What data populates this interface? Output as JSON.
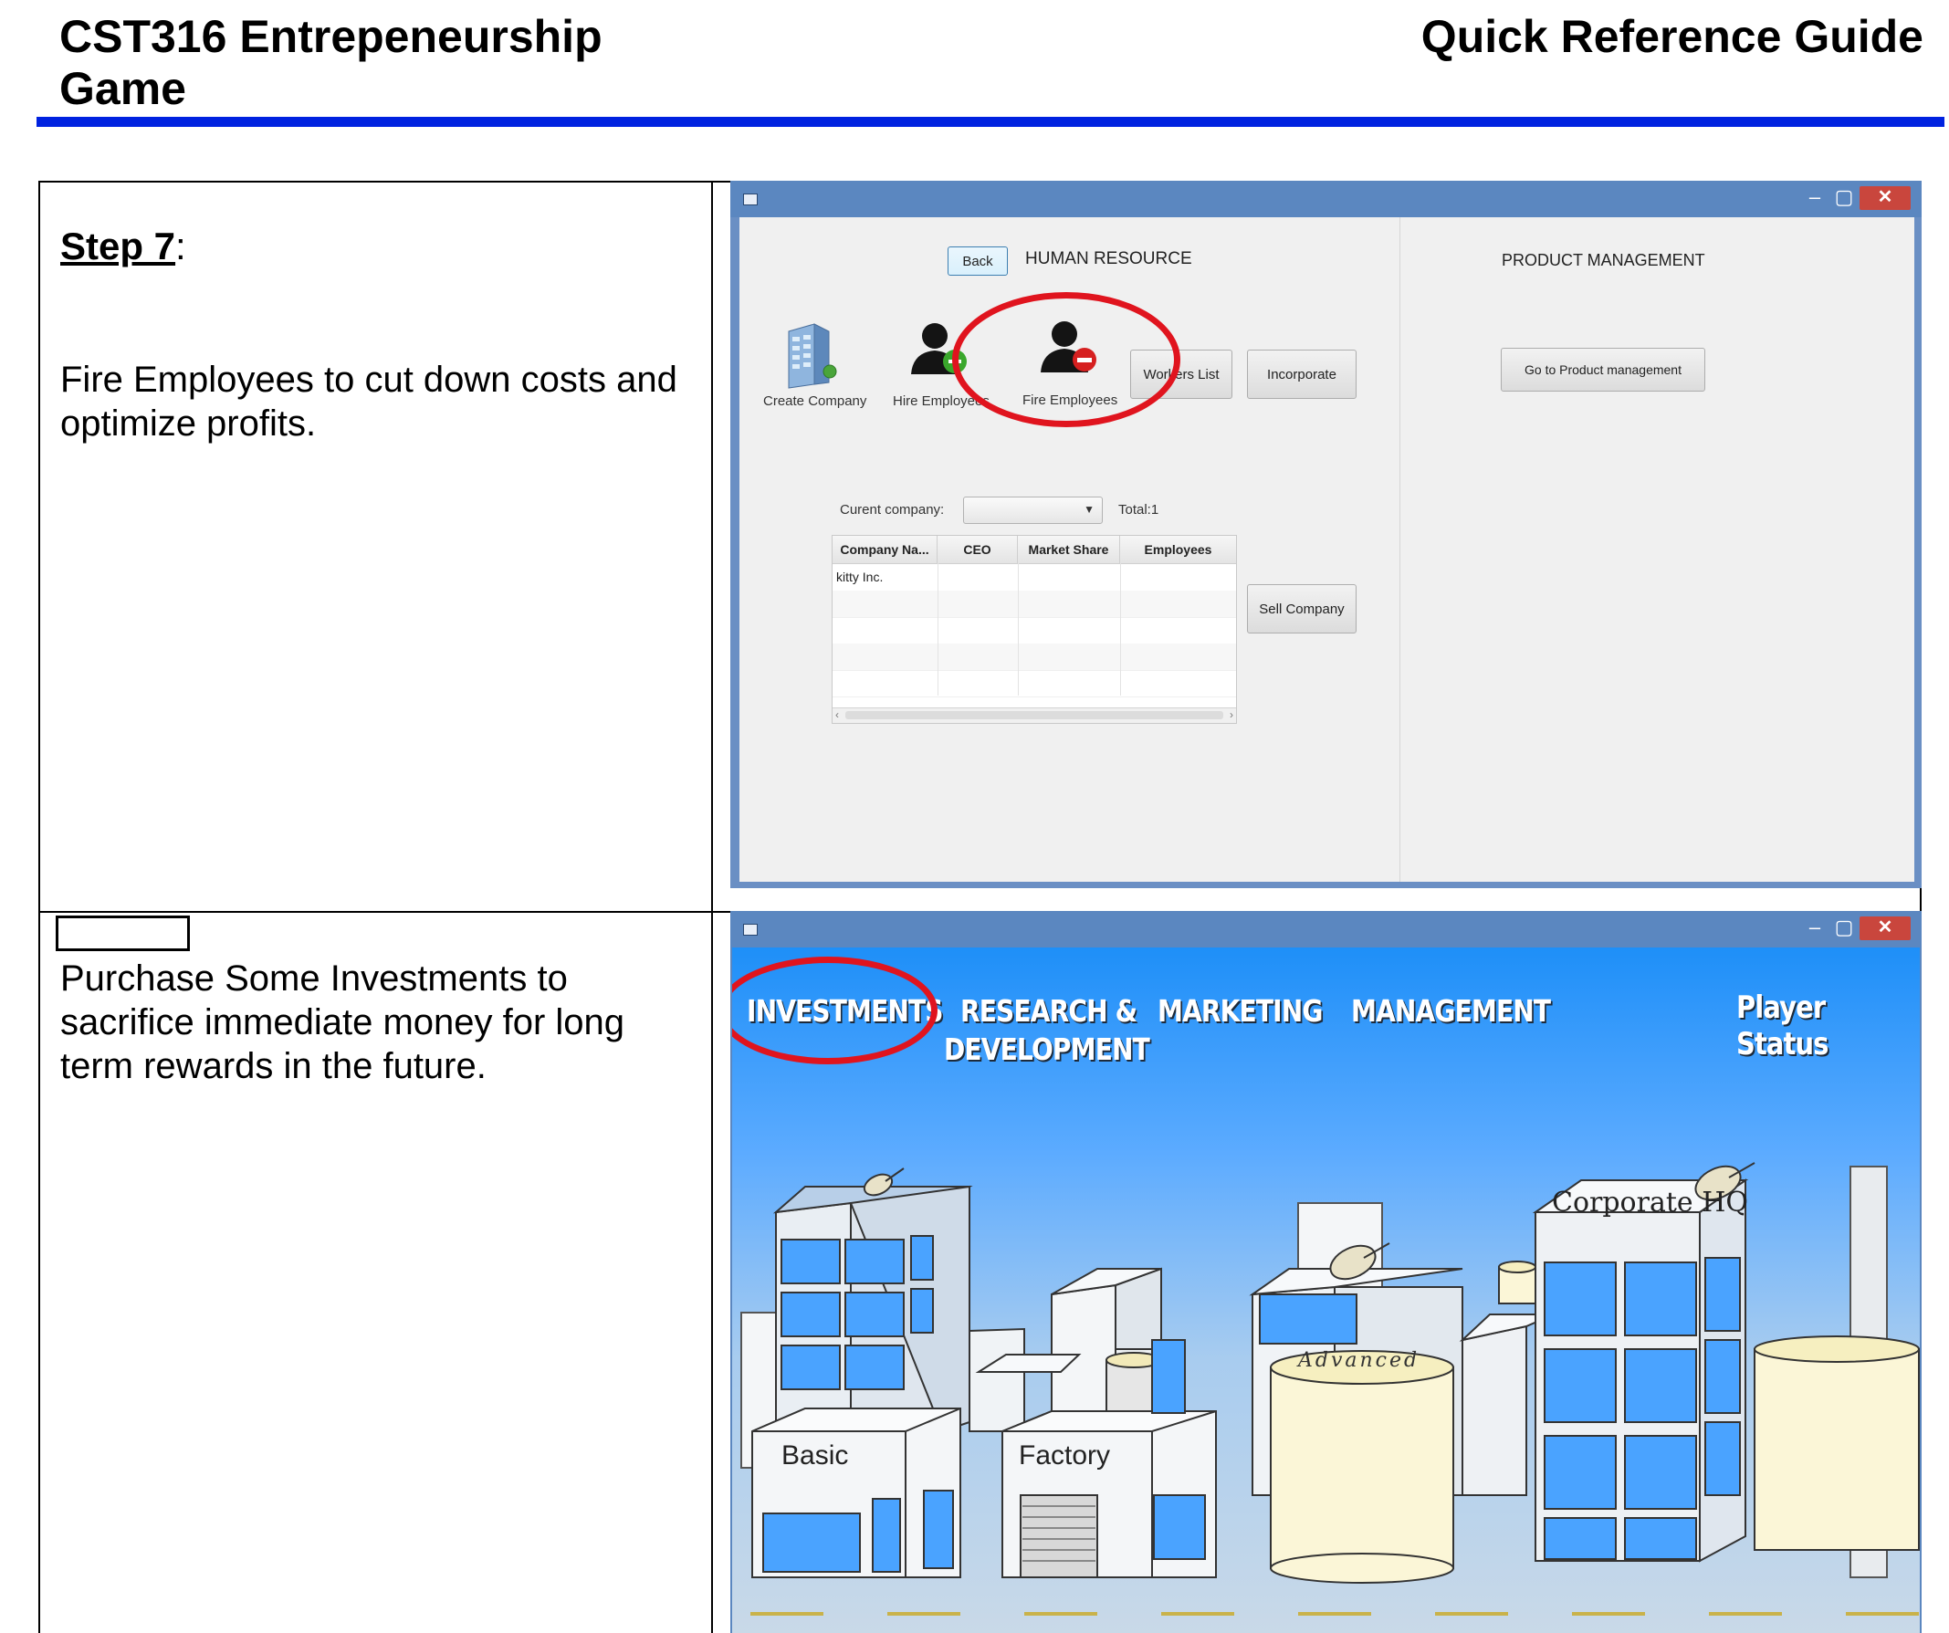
{
  "header": {
    "title": "CST316 Entrepeneurship Game",
    "right_title": "Quick Reference Guide",
    "rule_color": "#0022e0"
  },
  "step7": {
    "label": "Step 7",
    "label_suffix": ":",
    "text": "Fire Employees to cut down costs and optimize profits."
  },
  "step8": {
    "text": "Purchase Some Investments to sacrifice immediate money for long term rewards in the future."
  },
  "hr_window": {
    "back_label": "Back",
    "title": "HUMAN RESOURCE",
    "product_title": "PRODUCT MANAGEMENT",
    "product_button": "Go to Product management",
    "icons": [
      {
        "name": "building-icon",
        "label": "Create Company"
      },
      {
        "name": "hire-employee-icon",
        "label": "Hire Employees"
      },
      {
        "name": "fire-employee-icon",
        "label": "Fire Employees"
      }
    ],
    "workers_list": "Workers List",
    "incorporate": "Incorporate",
    "sell_company": "Sell Company",
    "current_company_label": "Curent company:",
    "total_label": "Total:1",
    "table": {
      "columns": [
        "Company Na...",
        "CEO",
        "Market Share",
        "Employees"
      ],
      "rows": [
        [
          "kitty Inc.",
          "",
          "",
          ""
        ]
      ]
    },
    "highlight_color": "#e0141e"
  },
  "game_window": {
    "menu": [
      "INVESTMENTS",
      "RESEARCH &",
      "DEVELOPMENT",
      "MARKETING",
      "MANAGEMENT",
      "Player Status"
    ],
    "buildings": {
      "basic": "Basic",
      "factory": "Factory",
      "advanced": "Advanced",
      "hq": "Corporate HQ"
    }
  }
}
